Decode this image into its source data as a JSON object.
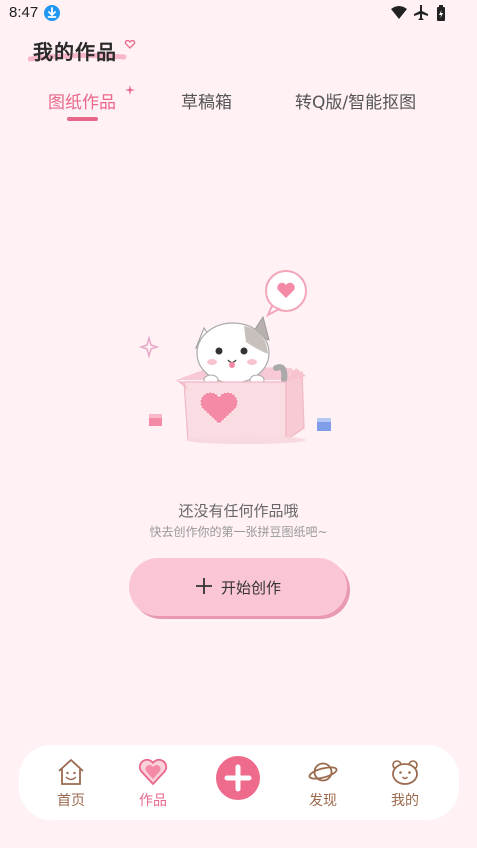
{
  "status_bar": {
    "time": "8:47",
    "icons": [
      "download-icon",
      "wifi-icon",
      "airplane-icon",
      "battery-icon"
    ]
  },
  "header": {
    "title": "我的作品"
  },
  "tabs": [
    {
      "label": "图纸作品",
      "active": true
    },
    {
      "label": "草稿箱",
      "active": false
    },
    {
      "label": "转Q版/智能抠图",
      "active": false
    }
  ],
  "empty_state": {
    "title": "还没有任何作品哦",
    "subtitle": "快去创作你的第一张拼豆图纸吧~",
    "button_label": "开始创作",
    "illustration": "cat-in-box-illustration"
  },
  "bottom_nav": {
    "items": [
      {
        "label": "首页",
        "icon": "home-icon",
        "active": false
      },
      {
        "label": "作品",
        "icon": "heart-icon",
        "active": true
      },
      {
        "label": "",
        "icon": "plus-icon",
        "active": false
      },
      {
        "label": "发现",
        "icon": "planet-icon",
        "active": false
      },
      {
        "label": "我的",
        "icon": "bear-face-icon",
        "active": false
      }
    ]
  },
  "colors": {
    "background": "#FFF1F4",
    "accent": "#E8678A",
    "button": "#FBC6D4",
    "nav_label": "#9B6A4E"
  }
}
